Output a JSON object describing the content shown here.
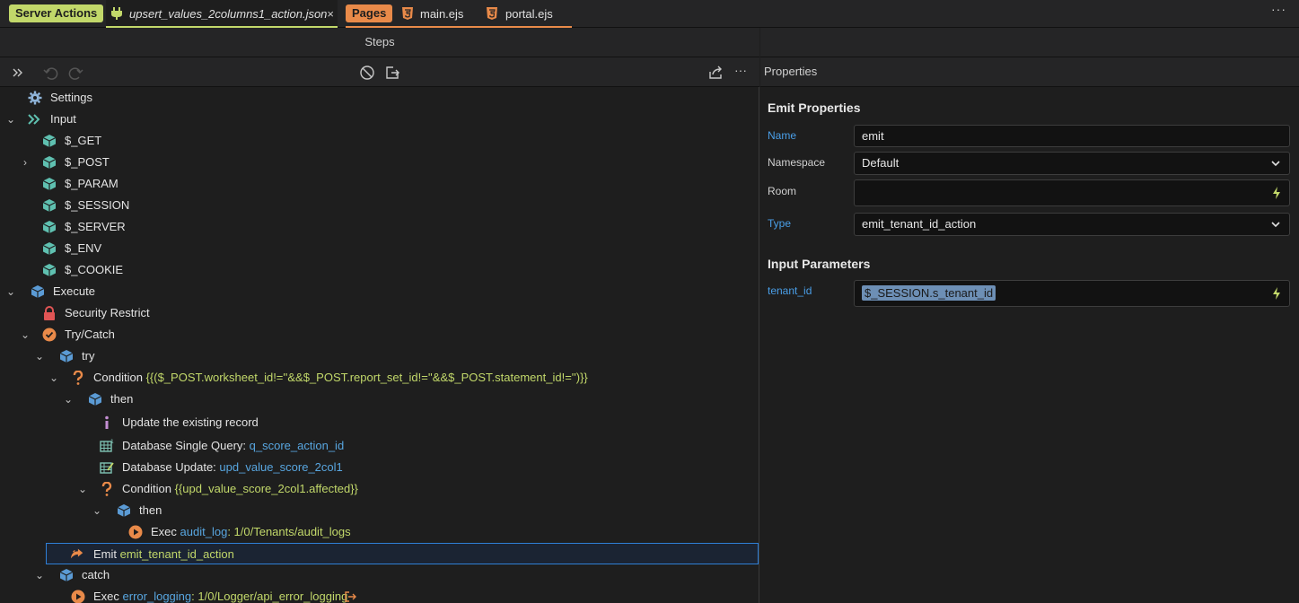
{
  "tabs": {
    "server_actions_label": "Server Actions",
    "active_file": "upsert_values_2columns1_action.json",
    "close": "×",
    "pages_label": "Pages",
    "page1": "main.ejs",
    "page2": "portal.ejs",
    "overflow": "···"
  },
  "steps": {
    "title": "Steps",
    "more": "···"
  },
  "tree": {
    "settings": "Settings",
    "input": "Input",
    "get": "$_GET",
    "post": "$_POST",
    "param": "$_PARAM",
    "session": "$_SESSION",
    "server": "$_SERVER",
    "env": "$_ENV",
    "cookie": "$_COOKIE",
    "execute": "Execute",
    "security": "Security Restrict",
    "trycatch": "Try/Catch",
    "try": "try",
    "cond1_label": "Condition",
    "cond1_expr": "{{($_POST.worksheet_id!=''&&$_POST.report_set_id!=''&&$_POST.statement_id!='')}}",
    "then1": "then",
    "comment": "Update the existing record",
    "dbq_label": "Database Single Query:",
    "dbq_name": "q_score_action_id",
    "dbu_label": "Database Update:",
    "dbu_name": "upd_value_score_2col1",
    "cond2_label": "Condition",
    "cond2_expr": "{{upd_value_score_2col1.affected}}",
    "then2": "then",
    "exec1_label": "Exec",
    "exec1_name": "audit_log",
    "exec1_path": ": 1/0/Tenants/audit_logs",
    "emit_label": "Emit",
    "emit_name": "emit_tenant_id_action",
    "catch": "catch",
    "exec2_label": "Exec",
    "exec2_name": "error_logging",
    "exec2_path": ": 1/0/Logger/api_error_logging"
  },
  "properties": {
    "title": "Properties",
    "emit_section": "Emit Properties",
    "name_label": "Name",
    "name_value": "emit",
    "namespace_label": "Namespace",
    "namespace_value": "Default",
    "room_label": "Room",
    "room_value": "",
    "type_label": "Type",
    "type_value": "emit_tenant_id_action",
    "input_section": "Input Parameters",
    "tenant_label": "tenant_id",
    "tenant_value": "$_SESSION.s_tenant_id"
  },
  "colors": {
    "accent_green": "#c2d86a",
    "accent_orange": "#e98a49",
    "link_blue": "#58a6e0",
    "selection_border": "#2f7fd6"
  }
}
